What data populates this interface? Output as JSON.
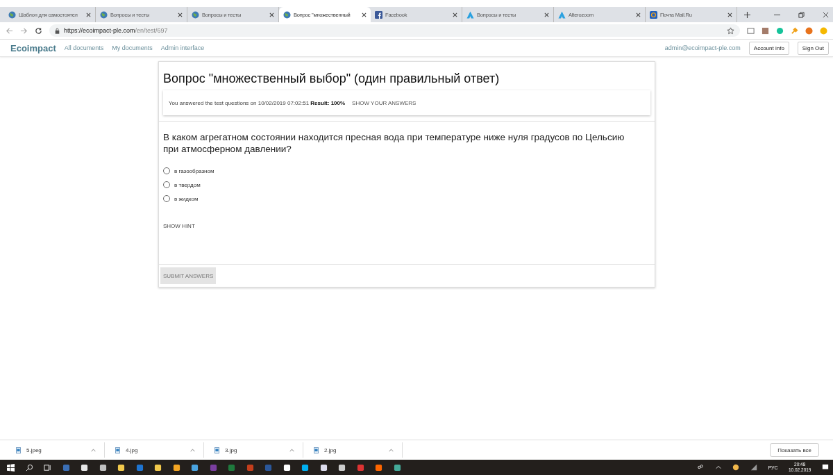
{
  "tabs": [
    {
      "title": "Шаблон для самостоятел",
      "kind": "globe",
      "selected": false
    },
    {
      "title": "Вопросы и тесты",
      "kind": "globe",
      "selected": false
    },
    {
      "title": "Вопросы и тесты",
      "kind": "globe",
      "selected": false
    },
    {
      "title": "Вопрос \"множественный",
      "kind": "globe",
      "selected": true
    },
    {
      "title": "Facebook",
      "kind": "facebook",
      "selected": false
    },
    {
      "title": "Вопросы и тесты",
      "kind": "triangle",
      "selected": false
    },
    {
      "title": "Alterozoom",
      "kind": "triangle",
      "selected": false
    },
    {
      "title": "Почта Mail.Ru",
      "kind": "mail",
      "selected": false
    }
  ],
  "address": {
    "host": "https://ecoimpact-ple.com",
    "path": "/en/test/697"
  },
  "nav": {
    "brand": "Ecoimpact",
    "links": [
      "All documents",
      "My documents",
      "Admin interface"
    ],
    "user": "admin@ecoimpact-ple.com",
    "buttons": [
      "Account info",
      "Sign Out"
    ]
  },
  "test": {
    "title": "Вопрос \"множественный выбор\" (один правильный ответ)",
    "result": "You answered the test questions on 10/02/2019 07:02:51 **Result: 100%**",
    "show_answers": "SHOW YOUR ANSWERS",
    "question": "В каком агрегатном состоянии находится пресная вода при температуре ниже нуля градусов по Цельсию при атмосферном давлении?",
    "options": [
      {
        "label": "в газообразном",
        "selected": false
      },
      {
        "label": "в твердом",
        "selected": false
      },
      {
        "label": "в жидком",
        "selected": false
      }
    ],
    "hint": "SHOW HINT",
    "submit": {
      "label": "SUBMIT ANSWERS",
      "disabled": true
    }
  },
  "downloads": {
    "items": [
      "5.jpeg",
      "4.jpg",
      "3.jpg",
      "2.jpg"
    ],
    "show_all": "Показать все"
  },
  "taskbar": {
    "language": "РУС",
    "time": "20:48",
    "date": "10.02.2019"
  }
}
